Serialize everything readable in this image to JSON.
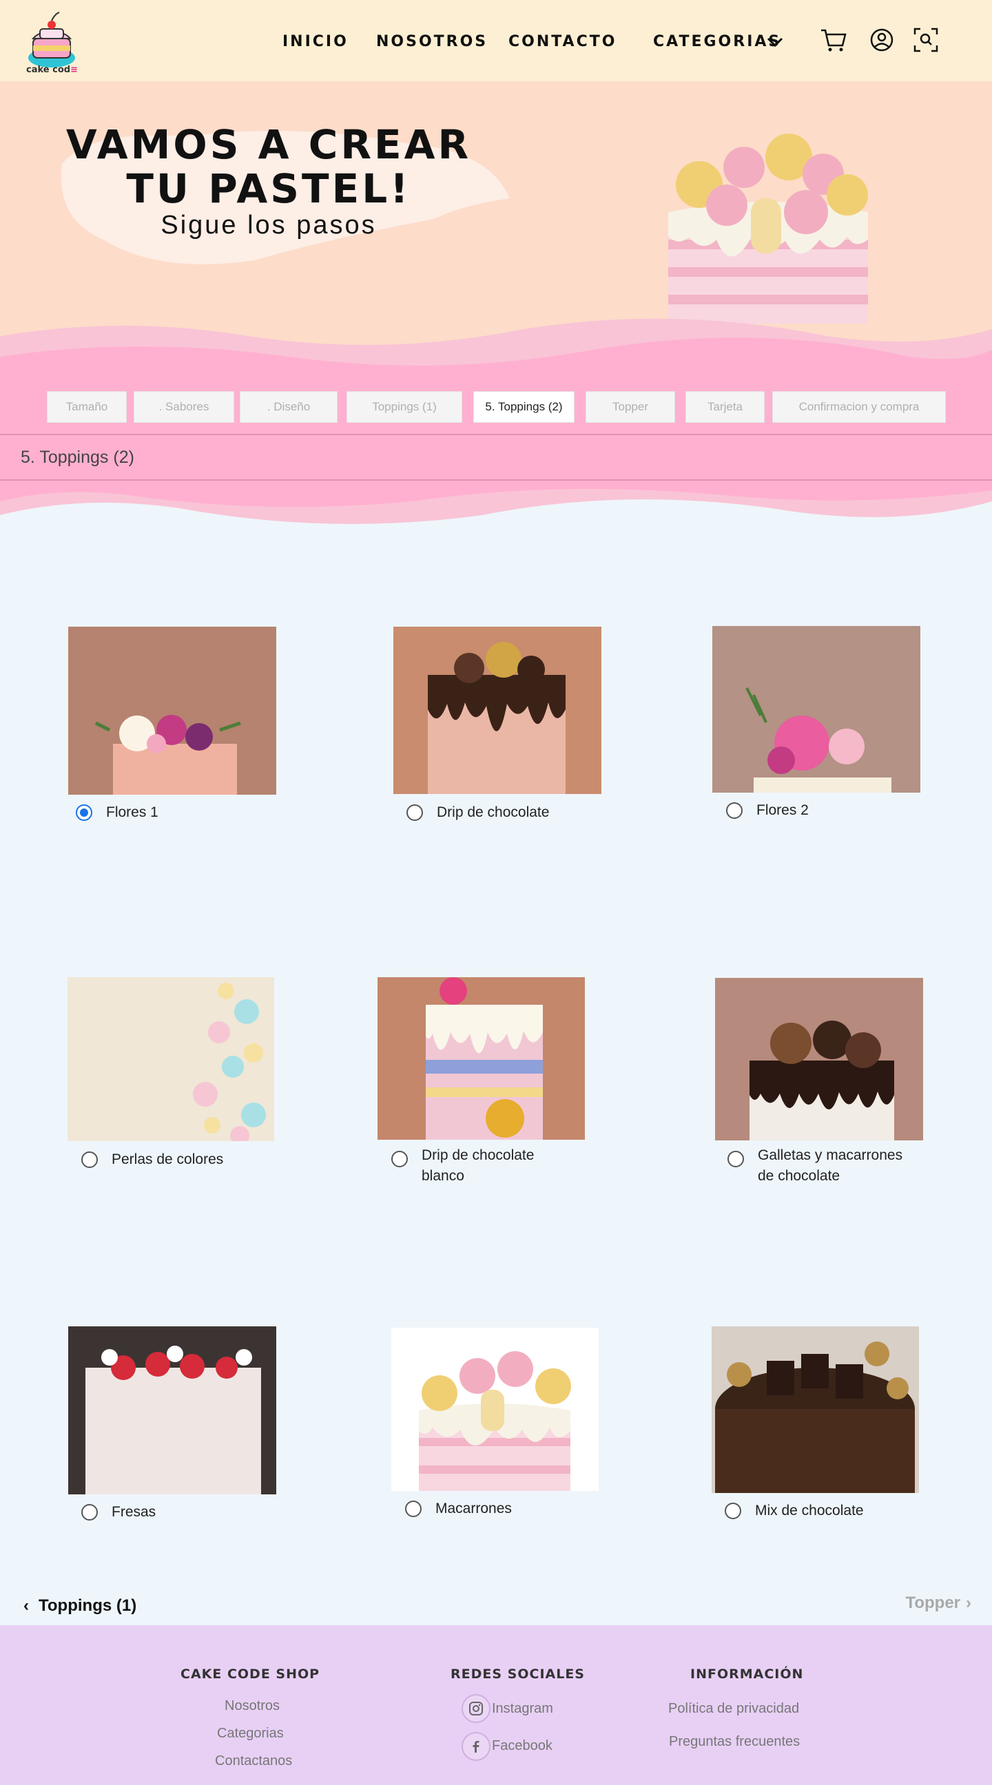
{
  "brand": {
    "name": "cake cod",
    "accent_char": "≡"
  },
  "nav": {
    "inicio": "INICIO",
    "nosotros": "NOSOTROS",
    "contacto": "CONTACTO",
    "categorias": "CATEGORIAS",
    "icons": [
      "cart-icon",
      "user-icon",
      "search-scan-icon"
    ]
  },
  "hero": {
    "title_line1": "VAMOS A CREAR",
    "title_line2": "TU PASTEL!",
    "subtitle": "Sigue los pasos"
  },
  "steps": [
    {
      "label": "Tamaño",
      "active": false
    },
    {
      "label": ". Sabores",
      "active": false
    },
    {
      "label": ". Diseño",
      "active": false
    },
    {
      "label": "Toppings (1)",
      "active": false
    },
    {
      "label": "5. Toppings (2)",
      "active": true
    },
    {
      "label": "Topper",
      "active": false
    },
    {
      "label": "Tarjeta",
      "active": false
    },
    {
      "label": "Confirmacion y compra",
      "active": false
    }
  ],
  "section_title": "5. Toppings (2)",
  "options": [
    {
      "label": "Flores 1",
      "selected": true
    },
    {
      "label": "Drip de chocolate",
      "selected": false
    },
    {
      "label": "Flores 2",
      "selected": false
    },
    {
      "label": "Perlas de colores",
      "selected": false
    },
    {
      "label": "Drip de chocolate blanco",
      "selected": false
    },
    {
      "label": "Galletas y macarrones de chocolate",
      "selected": false
    },
    {
      "label": "Fresas",
      "selected": false
    },
    {
      "label": "Macarrones",
      "selected": false
    },
    {
      "label": "Mix de chocolate",
      "selected": false
    }
  ],
  "pager": {
    "prev": "Toppings (1)",
    "next": "Topper"
  },
  "footer": {
    "shop_title": "CAKE CODE SHOP",
    "shop_links": [
      "Nosotros",
      "Categorias",
      "Contactanos"
    ],
    "social_title": "REDES SOCIALES",
    "social_links": [
      "Instagram",
      "Facebook"
    ],
    "info_title": "INFORMACIÓN",
    "info_links": [
      "Política de privacidad",
      "Preguntas frecuentes"
    ]
  },
  "colors": {
    "header_bg": "#fdefd3",
    "hero_bg": "#fddcc9",
    "pink_band": "#ffb0d0",
    "page_bg": "#eef6fb",
    "footer_bg": "#e8d0f5",
    "radio_selected": "#1a73e8"
  }
}
